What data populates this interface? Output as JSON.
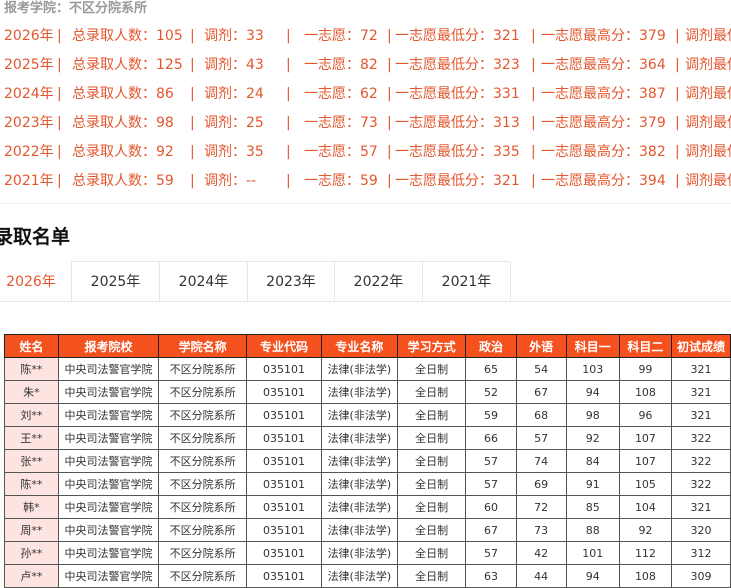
{
  "school_label": "报考学院：不区分院系所",
  "stats": [
    {
      "year": "2026年",
      "total": "总录取人数：105",
      "adjust": "调剂：33",
      "first": "一志愿：72",
      "min": "一志愿最低分：321",
      "max": "一志愿最高分：379",
      "adjmin": "调剂最低分"
    },
    {
      "year": "2025年",
      "total": "总录取人数：125",
      "adjust": "调剂：43",
      "first": "一志愿：82",
      "min": "一志愿最低分：323",
      "max": "一志愿最高分：364",
      "adjmin": "调剂最低分"
    },
    {
      "year": "2024年",
      "total": "总录取人数：86",
      "adjust": "调剂：24",
      "first": "一志愿：62",
      "min": "一志愿最低分：331",
      "max": "一志愿最高分：387",
      "adjmin": "调剂最低分"
    },
    {
      "year": "2023年",
      "total": "总录取人数：98",
      "adjust": "调剂：25",
      "first": "一志愿：73",
      "min": "一志愿最低分：313",
      "max": "一志愿最高分：379",
      "adjmin": "调剂最低分"
    },
    {
      "year": "2022年",
      "total": "总录取人数：92",
      "adjust": "调剂：35",
      "first": "一志愿：57",
      "min": "一志愿最低分：335",
      "max": "一志愿最高分：382",
      "adjmin": "调剂最低分"
    },
    {
      "year": "2021年",
      "total": "总录取人数：59",
      "adjust": "调剂：--",
      "first": "一志愿：59",
      "min": "一志愿最低分：321",
      "max": "一志愿最高分：394",
      "adjmin": "调剂最低分"
    }
  ],
  "separator": "|",
  "section_title": "录取名单",
  "tabs": [
    "2026年",
    "2025年",
    "2024年",
    "2023年",
    "2022年",
    "2021年"
  ],
  "active_tab": "2026年",
  "table": {
    "headers": [
      "姓名",
      "报考院校",
      "学院名称",
      "专业代码",
      "专业名称",
      "学习方式",
      "政治",
      "外语",
      "科目一",
      "科目二",
      "初试成绩"
    ],
    "rows": [
      [
        "陈**",
        "中央司法警官学院",
        "不区分院系所",
        "035101",
        "法律(非法学)",
        "全日制",
        "65",
        "54",
        "103",
        "99",
        "321"
      ],
      [
        "朱*",
        "中央司法警官学院",
        "不区分院系所",
        "035101",
        "法律(非法学)",
        "全日制",
        "52",
        "67",
        "94",
        "108",
        "321"
      ],
      [
        "刘**",
        "中央司法警官学院",
        "不区分院系所",
        "035101",
        "法律(非法学)",
        "全日制",
        "59",
        "68",
        "98",
        "96",
        "321"
      ],
      [
        "王**",
        "中央司法警官学院",
        "不区分院系所",
        "035101",
        "法律(非法学)",
        "全日制",
        "66",
        "57",
        "92",
        "107",
        "322"
      ],
      [
        "张**",
        "中央司法警官学院",
        "不区分院系所",
        "035101",
        "法律(非法学)",
        "全日制",
        "57",
        "74",
        "84",
        "107",
        "322"
      ],
      [
        "陈**",
        "中央司法警官学院",
        "不区分院系所",
        "035101",
        "法律(非法学)",
        "全日制",
        "57",
        "69",
        "91",
        "105",
        "322"
      ],
      [
        "韩*",
        "中央司法警官学院",
        "不区分院系所",
        "035101",
        "法律(非法学)",
        "全日制",
        "60",
        "72",
        "85",
        "104",
        "321"
      ],
      [
        "周**",
        "中央司法警官学院",
        "不区分院系所",
        "035101",
        "法律(非法学)",
        "全日制",
        "67",
        "73",
        "88",
        "92",
        "320"
      ],
      [
        "孙**",
        "中央司法警官学院",
        "不区分院系所",
        "035101",
        "法律(非法学)",
        "全日制",
        "57",
        "42",
        "101",
        "112",
        "312"
      ],
      [
        "卢**",
        "中央司法警官学院",
        "不区分院系所",
        "035101",
        "法律(非法学)",
        "全日制",
        "63",
        "44",
        "94",
        "108",
        "309"
      ]
    ]
  }
}
